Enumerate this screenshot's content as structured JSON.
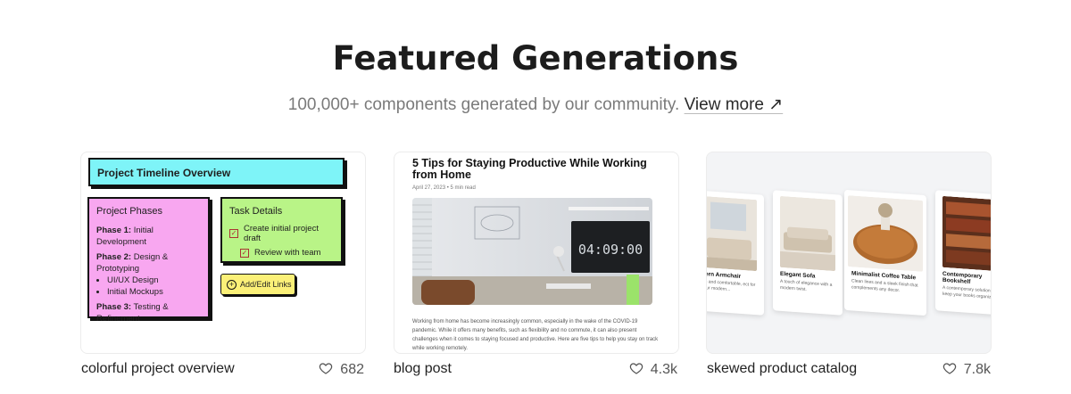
{
  "header": {
    "title": "Featured Generations",
    "subtitle": "100,000+ components generated by our community.",
    "view_more": "View more ↗"
  },
  "cards": [
    {
      "caption": "colorful project overview",
      "likes": "682",
      "preview": {
        "header": "Project Timeline Overview",
        "phases_title": "Project Phases",
        "phase1_label": "Phase 1:",
        "phase1_text": "Initial Development",
        "phase2_label": "Phase 2:",
        "phase2_text": "Design & Prototyping",
        "phase2_items": [
          "UI/UX Design",
          "Initial Mockups"
        ],
        "phase3_label": "Phase 3:",
        "phase3_text": "Testing & Refinement",
        "tasks_title": "Task Details",
        "task1": "Create initial project draft",
        "task2": "Review with team",
        "button": "Add/Edit Links"
      }
    },
    {
      "caption": "blog post",
      "likes": "4.3k",
      "preview": {
        "title": "5 Tips for Staying Productive While Working from Home",
        "date": "April 27, 2023 • 5 min read",
        "clock": "04:09:00",
        "body": "Working from home has become increasingly common, especially in the wake of the COVID-19 pandemic. While it offers many benefits, such as flexibility and no commute, it can also present challenges when it comes to staying focused and productive. Here are five tips to help you stay on track while working remotely."
      }
    },
    {
      "caption": "skewed product catalog",
      "likes": "7.8k",
      "preview": {
        "products": [
          {
            "name": "dern Armchair",
            "desc": "ish and comfortable, ect for your modern..."
          },
          {
            "name": "Elegant Sofa",
            "desc": "A touch of elegance with a modern twist."
          },
          {
            "name": "Minimalist Coffee Table",
            "desc": "Clean lines and a sleek finish that complements any decor."
          },
          {
            "name": "Contemporary Bookshelf",
            "desc": "A contemporary solution keep your books organiz..."
          }
        ]
      }
    }
  ],
  "colors": {
    "cyan": "#7ef4f8",
    "pink": "#f8a7f0",
    "green": "#b9f487",
    "yellow": "#fbf078"
  }
}
